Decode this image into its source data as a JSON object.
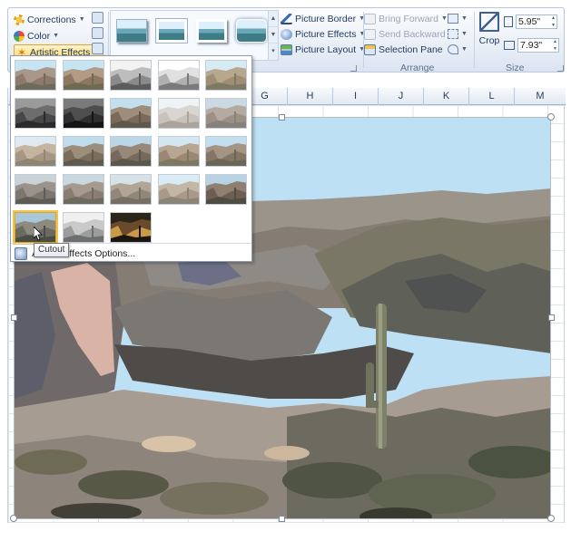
{
  "ribbon": {
    "adjust": {
      "corrections_label": "Corrections",
      "color_label": "Color",
      "artistic_effects_label": "Artistic Effects"
    },
    "picture_commands": {
      "border_label": "Picture Border",
      "effects_label": "Picture Effects",
      "layout_label": "Picture Layout"
    },
    "arrange": {
      "bring_forward_label": "Bring Forward",
      "send_backward_label": "Send Backward",
      "selection_pane_label": "Selection Pane",
      "group_label": "Arrange"
    },
    "size": {
      "crop_label": "Crop",
      "height_value": "5.95\"",
      "width_value": "7.93\"",
      "group_label": "Size"
    }
  },
  "sheet": {
    "columns": [
      "G",
      "H",
      "I",
      "J",
      "K",
      "L",
      "M"
    ]
  },
  "effects_panel": {
    "options_label": "Artistic Effects Options...",
    "thumbnails": [
      {
        "effect": "none"
      },
      {
        "effect": "marker"
      },
      {
        "effect": "pencil-grayscale"
      },
      {
        "effect": "pencil-sketch"
      },
      {
        "effect": "line-drawing"
      },
      {
        "effect": "chalk-sketch"
      },
      {
        "effect": "paint-strokes"
      },
      {
        "effect": "paint-brush"
      },
      {
        "effect": "glow-diffused"
      },
      {
        "effect": "blur"
      },
      {
        "effect": "light-screen"
      },
      {
        "effect": "watercolor-sponge"
      },
      {
        "effect": "film-grain"
      },
      {
        "effect": "mosaic-bubbles"
      },
      {
        "effect": "glass"
      },
      {
        "effect": "cement"
      },
      {
        "effect": "texturizer"
      },
      {
        "effect": "crisscross-etching"
      },
      {
        "effect": "pastels-smooth"
      },
      {
        "effect": "plastic-wrap"
      },
      {
        "effect": "cutout",
        "selected": true
      },
      {
        "effect": "photocopy"
      },
      {
        "effect": "glow-edges"
      }
    ]
  },
  "tooltip": {
    "text": "Cutout"
  },
  "colors": {
    "highlight": "#f3c34d",
    "sky": "#bde0f4",
    "ribbon_text": "#1e395b"
  }
}
